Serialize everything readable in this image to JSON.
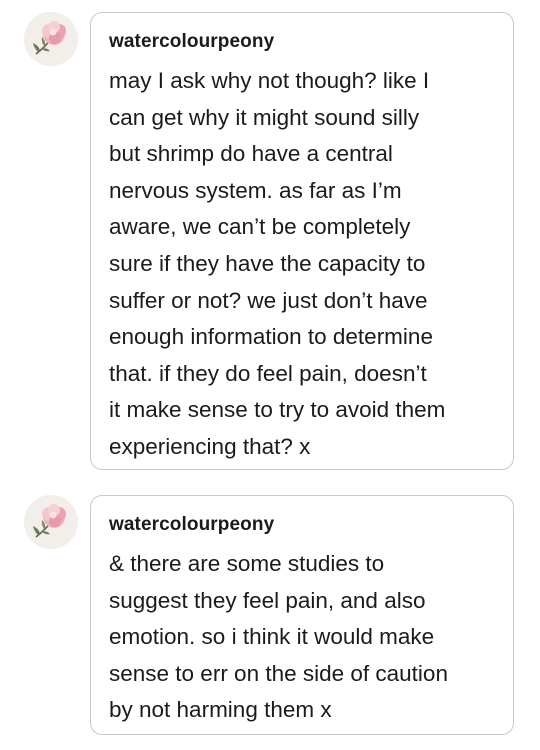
{
  "messages": [
    {
      "username": "watercolourpeony",
      "avatar_icon": "peony-flower-icon",
      "text": "may I ask why not though? like I\ncan get why it might sound silly\nbut shrimp do have a central\nnervous system. as far as I’m\naware, we can’t be completely\nsure if they have the capacity to\nsuffer or not? we just don’t have\nenough information to determine\nthat. if they do feel pain, doesn’t\nit make sense to try to avoid them\nexperiencing that? x"
    },
    {
      "username": "watercolourpeony",
      "avatar_icon": "peony-flower-icon",
      "text": "& there are some studies to\nsuggest they feel pain, and also\nemotion. so i think it would make\nsense to err on the side of caution\nby not harming them x"
    }
  ],
  "colors": {
    "bubble_border": "#c9c9c9",
    "text": "#1b1b1b",
    "avatar_bg": "#f2efeb",
    "petal": "#e9a9b3",
    "leaf": "#5e6b4a"
  }
}
